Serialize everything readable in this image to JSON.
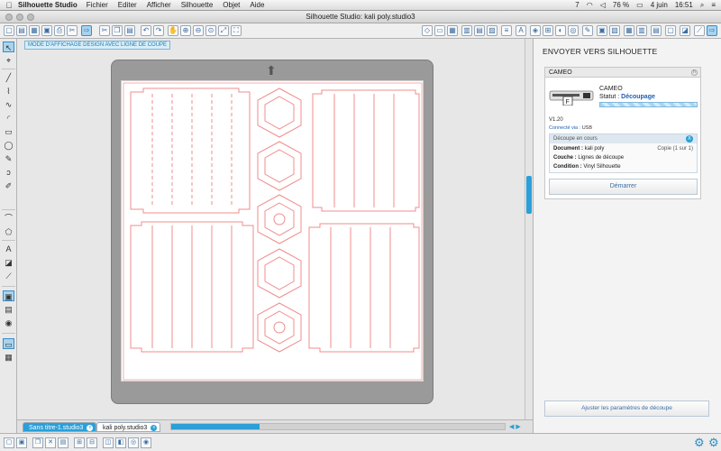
{
  "menubar": {
    "app_name": "Silhouette Studio",
    "menus": [
      "Fichier",
      "Editer",
      "Afficher",
      "Silhouette",
      "Objet",
      "Aide"
    ],
    "status": {
      "battery": "76 %",
      "date": "4 juin",
      "time": "16:51",
      "notifications": "7"
    }
  },
  "window": {
    "title": "Silhouette Studio: kali poly.studio3"
  },
  "canvas": {
    "mode_label": "MODE D'AFFICHAGE DESIGN AVEC LIGNE DE COUPE"
  },
  "panel": {
    "title": "ENVOYER VERS SILHOUETTE",
    "device": {
      "header": "CAMEO",
      "name": "CAMEO",
      "status_label": "Statut :",
      "status_value": "Découpage",
      "version": "V1.20",
      "connected_label": "Connecté via :",
      "connected_value": "USB"
    },
    "job": {
      "header": "Découpe en cours",
      "close_label": "X",
      "document_label": "Document :",
      "document_value": "kali poly",
      "copy": "Copie (1 sur 1)",
      "layer_label": "Couche :",
      "layer_value": "Lignes de découpe",
      "condition_label": "Condition :",
      "condition_value": "Vinyl Silhouette"
    },
    "start_button": "Démarrer",
    "adjust_button": "Ajuster les paramètres de découpe"
  },
  "tabs": [
    {
      "label": "Sans titre-1.studio3",
      "close": "x"
    },
    {
      "label": "kali poly.studio3",
      "close": "x"
    }
  ],
  "colors": {
    "accent": "#2a9fd8",
    "cut_line": "#f08c8c"
  }
}
